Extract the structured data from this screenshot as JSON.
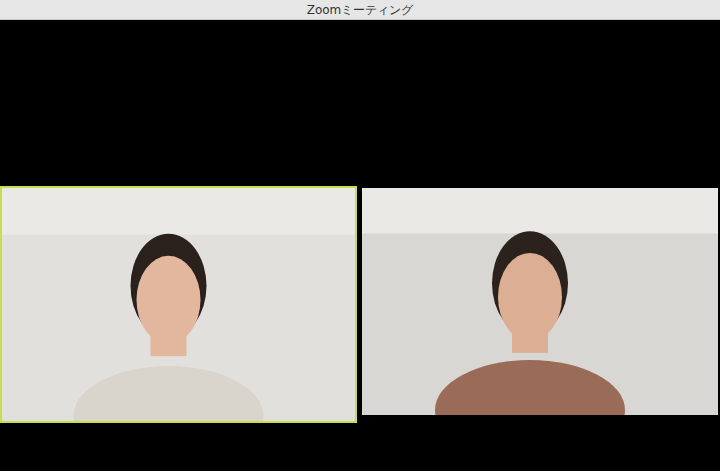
{
  "window": {
    "title": "Zoomミーティング"
  },
  "tiles": [
    {
      "active": true
    },
    {
      "active": false
    }
  ]
}
